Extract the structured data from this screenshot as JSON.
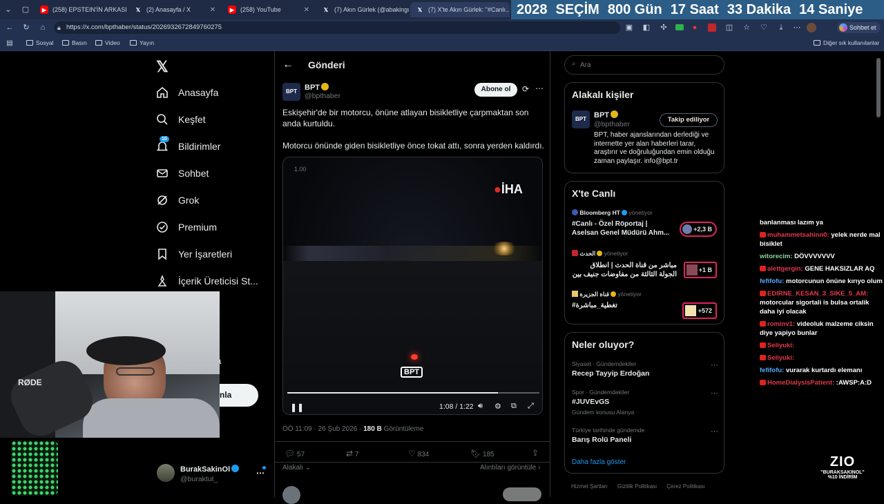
{
  "tabs": [
    {
      "label": "(258) EPSTEIN'İN ARKASINDAKİ",
      "kind": "youtube"
    },
    {
      "label": "(2) Anasayfa / X",
      "kind": "x"
    },
    {
      "label": "(258) YouTube",
      "kind": "youtube"
    },
    {
      "label": "(7) Akın Gürlek (@abakingu...",
      "kind": "x"
    },
    {
      "label": "(7) X'te Akın Gürlek: \"#Canlı...",
      "kind": "x"
    }
  ],
  "countdown": {
    "year": "2028",
    "word": "SEÇİM",
    "days": "800 Gün",
    "hours": "17 Saat",
    "minutes": "33 Dakika",
    "seconds": "14 Saniye"
  },
  "address": {
    "url": "https://x.com/bpthaber/status/2026932672849760275",
    "chat_label": "Sohbet et"
  },
  "bookmarks": [
    "Sosyal",
    "Basın",
    "Video",
    "Yayın"
  ],
  "bookmarks_other": "Diğer sık kullanılanlar",
  "nav": {
    "home": "Anasayfa",
    "explore": "Keşfet",
    "notifications": "Bildirimler",
    "notif_count": "10",
    "chat": "Sohbet",
    "grok": "Grok",
    "premium": "Premium",
    "bookmarks": "Yer İşaretleri",
    "creator": "İçerik Üreticisi St...",
    "post_partial": "nla",
    "more_partial": "a"
  },
  "account": {
    "name": "BurakSakinOl",
    "handle": "@buraktut_"
  },
  "post": {
    "header": "Gönderi",
    "author_name": "BPT",
    "author_handle": "@bpthaber",
    "subscribe": "Abone ol",
    "text1": "Eskişehir'de bir motorcu, önüne atlayan bisikletliye çarpmaktan son anda kurtuldu.",
    "text2": "Motorcu önünde giden bisikletliye önce tokat attı, sonra yerden kaldırdı.",
    "video_rate": "1.00",
    "video_time": "1:08 / 1:22",
    "video_progress": 0.836,
    "video_watermark": "İHA",
    "video_logo": "BPT",
    "meta_time": "ÖÖ 11:09 · 26 Şub 2026 · ",
    "views": "180 B",
    "views_label": " Görüntüleme",
    "replies": "57",
    "reposts": "7",
    "likes": "834",
    "bookmarks": "185",
    "related_label": "Alakalı",
    "quotes_label": "Alıntıları görüntüle"
  },
  "search": {
    "placeholder": "Ara"
  },
  "related_people": {
    "title": "Alakalı kişiler",
    "name": "BPT",
    "handle": "@bpthaber",
    "follow_label": "Takip ediliyor",
    "bio": "BPT, haber ajanslarından derlediği ve internette yer alan haberleri tarar, araştırır ve doğruluğundan emin olduğu zaman paylaşır. info@bpt.tr"
  },
  "live": {
    "title": "X'te Canlı",
    "items": [
      {
        "host": "Bloomberg HT",
        "role": "yönetiyor",
        "title": "#Canlı - Özel Röportaj | Aselsan Genel Müdürü Ahm...",
        "count": "+2,3 B"
      },
      {
        "host": "الحدث",
        "role": "yönetiyor",
        "title": "مباشر من قناة الحدث | انطلاق الجولة الثالثة من مفاوضات جنيف بين إيران ...",
        "count": "+1 B"
      },
      {
        "host": "قناة الجزيرة",
        "role": "yönetiyor",
        "title": "#تغطية_مباشرة",
        "count": "+572"
      }
    ]
  },
  "trends": {
    "title": "Neler oluyor?",
    "items": [
      {
        "context": "Siyaset · Gündemdekiler",
        "name": "Recep Tayyip Erdoğan",
        "extra": ""
      },
      {
        "context": "Spor · Gündemdekiler",
        "name": "#JUVEvGS",
        "extra": "Gündem konusu Alanya"
      },
      {
        "context": "Türkiye tarihinde gündemde",
        "name": "Barış Rolü Paneli",
        "extra": ""
      }
    ],
    "show_more": "Daha fazla göster"
  },
  "footer_links": [
    "Hizmet Şartları",
    "Gizlilik Politikası",
    "Çerez Politikası"
  ],
  "webcam": {
    "mic_brand": "RØDE"
  },
  "chat": [
    {
      "user": "",
      "msg": "banlanması lazım ya",
      "color": "white"
    },
    {
      "user": "muhammetsahinn0:",
      "msg": " yelek nerde mal bisiklet",
      "color": "red"
    },
    {
      "user": "witorecim:",
      "msg": " DÖVVVVVVV",
      "color": "green"
    },
    {
      "user": "alettgergin:",
      "msg": " GENE HAKSIZLAR AQ",
      "color": "red"
    },
    {
      "user": "fefifofu:",
      "msg": " motorcunun önüne kırıyo olum",
      "color": "blue"
    },
    {
      "user": "EDIRNE_KESAN_3_SIKE_5_AM:",
      "msg": " motorcular sigortali is bulsa ortalik daha iyi olacak",
      "color": "red"
    },
    {
      "user": "rominv1:",
      "msg": " videoluk malzeme ciksin diye yapiyo bunlar",
      "color": "red"
    },
    {
      "user": "Seliyuki:",
      "msg": "",
      "color": "red"
    },
    {
      "user": "Seliyuki:",
      "msg": "",
      "color": "red"
    },
    {
      "user": "fefifofu:",
      "msg": " vurarak kurtardı elemanı",
      "color": "blue"
    },
    {
      "user": "HomeDialysisPatient:",
      "msg": " :AWSP:A:D",
      "color": "red"
    }
  ],
  "promo": {
    "brand": "ZIO",
    "code": "\"BURAKSAKINOL\"",
    "discount": "%10 İNDİRİM"
  }
}
